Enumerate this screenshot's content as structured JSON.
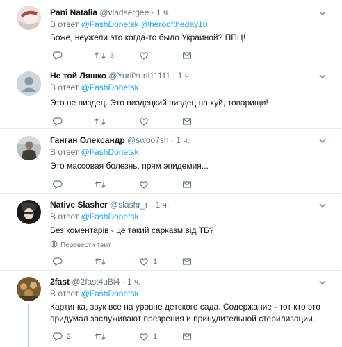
{
  "tweets": [
    {
      "name": "Pani Natalia",
      "handle": "@vladsergee",
      "time": "1 ч.",
      "reply_prefix": "В ответ",
      "reply_to": [
        "@FashDonetsk",
        "@herooftheday10"
      ],
      "text": "Боже, неужели это когда-то было Украиной? ППЦ!",
      "replies": "",
      "retweets": "3",
      "likes": ""
    },
    {
      "name": "Не той Ляшко",
      "handle": "@YuriiYurii11111",
      "time": "1 ч.",
      "reply_prefix": "В ответ",
      "reply_to": [
        "@FashDonetsk"
      ],
      "text": "Это не пиздец. Это пиздецкий пиздец на хуй, товарищи!",
      "replies": "",
      "retweets": "",
      "likes": ""
    },
    {
      "name": "Ганган Олександр",
      "handle": "@swoo7sh",
      "time": "1 ч.",
      "reply_prefix": "В ответ",
      "reply_to": [
        "@FashDonetsk"
      ],
      "text": "Это массовая болезнь, прям эпидемия...",
      "replies": "",
      "retweets": "",
      "likes": ""
    },
    {
      "name": "Native Slasher",
      "handle": "@slashr_r",
      "time": "1 ч.",
      "reply_prefix": "В ответ",
      "reply_to": [
        "@FashDonetsk"
      ],
      "text": "Без коментарів - це такий сарказм від ТБ?",
      "translate": "Перевести твит",
      "replies": "",
      "retweets": "",
      "likes": "1"
    },
    {
      "name": "2fast",
      "handle": "@2fast4uBi4",
      "time": "1 ч.",
      "reply_prefix": "В ответ",
      "reply_to": [
        "@FashDonetsk"
      ],
      "text": "Картинка, звук все на уровне детского сада. Содержание - тот кто это придумал заслуживают презрения и принудительной стерилизации.",
      "replies": "2",
      "retweets": "",
      "likes": "1"
    }
  ],
  "colors": {
    "accent": "#1da1f2",
    "muted": "#657786",
    "text": "#14171a",
    "divider": "#e6ecf0",
    "thread": "#a5d3f5"
  },
  "icons": {
    "reply": "reply-icon",
    "retweet": "retweet-icon",
    "like": "heart-icon",
    "dm": "message-icon",
    "caret": "chevron-down-icon",
    "translate": "globe-icon"
  }
}
